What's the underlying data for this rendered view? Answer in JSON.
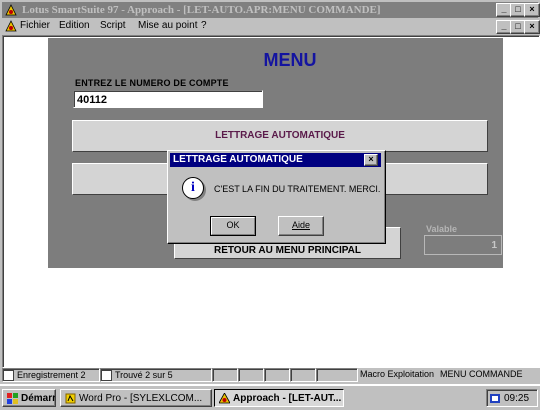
{
  "window": {
    "title": "Lotus SmartSuite 97   -  Approach - [LET-AUTO.APR:MENU COMMANDE]",
    "min_label": "_",
    "max_label": "□",
    "close_label": "×"
  },
  "menubar": {
    "items": [
      "Fichier",
      "Edition",
      "Script",
      "Mise au point",
      "?"
    ]
  },
  "form": {
    "title": "MENU",
    "account_label": "ENTREZ LE NUMERO DE COMPTE",
    "account_value": "40112",
    "button_lettrage": "LETTRAGE AUTOMATIQUE",
    "button_retour": "RETOUR AU MENU PRINCIPAL",
    "valable_label": "Valable",
    "valable_value": "1"
  },
  "dialog": {
    "title": "LETTRAGE AUTOMATIQUE",
    "close_label": "×",
    "icon": "info-icon",
    "message": "C'EST LA FIN DU TRAITEMENT. MERCI.",
    "ok_label": "OK",
    "help_label": "Aide"
  },
  "statusbar": {
    "record": "Enregistrement 2",
    "found": "Trouvé 2 sur 5",
    "macro": "Macro Exploitation",
    "view": "MENU COMMANDE"
  },
  "taskbar": {
    "start_label": "Démarrer",
    "tasks": [
      "Word Pro - [SYLEXLCOM...",
      "Approach - [LET-AUT..."
    ],
    "clock": "09:25"
  },
  "colors": {
    "titlebar_inactive": "#808080",
    "dialog_titlebar": "#000080",
    "form_background": "#7d7d7d",
    "menu_title": "#1414a0"
  }
}
